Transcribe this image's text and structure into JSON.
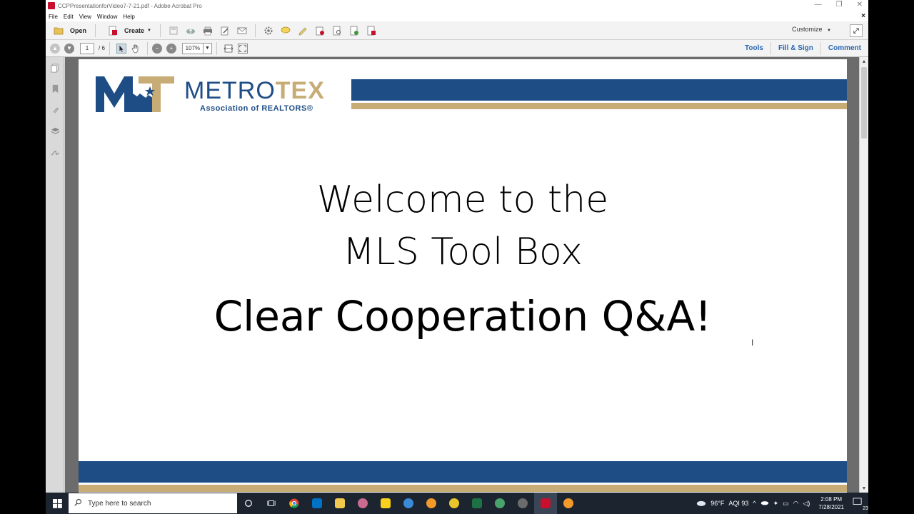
{
  "window": {
    "title": "CCPPresentationforVideo7-7-21.pdf - Adobe Acrobat Pro",
    "controls": [
      "—",
      "❐",
      "✕"
    ]
  },
  "menu": {
    "items": [
      "File",
      "Edit",
      "View",
      "Window",
      "Help"
    ],
    "close": "×"
  },
  "toolbar": {
    "open_label": "Open",
    "create_label": "Create",
    "customize_label": "Customize"
  },
  "navigation": {
    "current_page": "1",
    "page_total": "/ 6",
    "zoom": "107%"
  },
  "panels": {
    "tools": "Tools",
    "fill_sign": "Fill & Sign",
    "comment": "Comment"
  },
  "slide": {
    "brand_primary": "METRO",
    "brand_secondary": "TEX",
    "brand_sub": "Association of REALTORS®",
    "line1": "Welcome to the",
    "line2": "MLS Tool Box",
    "line3": "Clear Cooperation Q&A!",
    "colors": {
      "blue": "#1e4d86",
      "gold": "#c7ad75"
    }
  },
  "taskbar": {
    "search_placeholder": "Type here to search",
    "weather": "96°F",
    "aqi": "AQI 93",
    "time": "2:08 PM",
    "date": "7/28/2021",
    "notifications": "23"
  }
}
